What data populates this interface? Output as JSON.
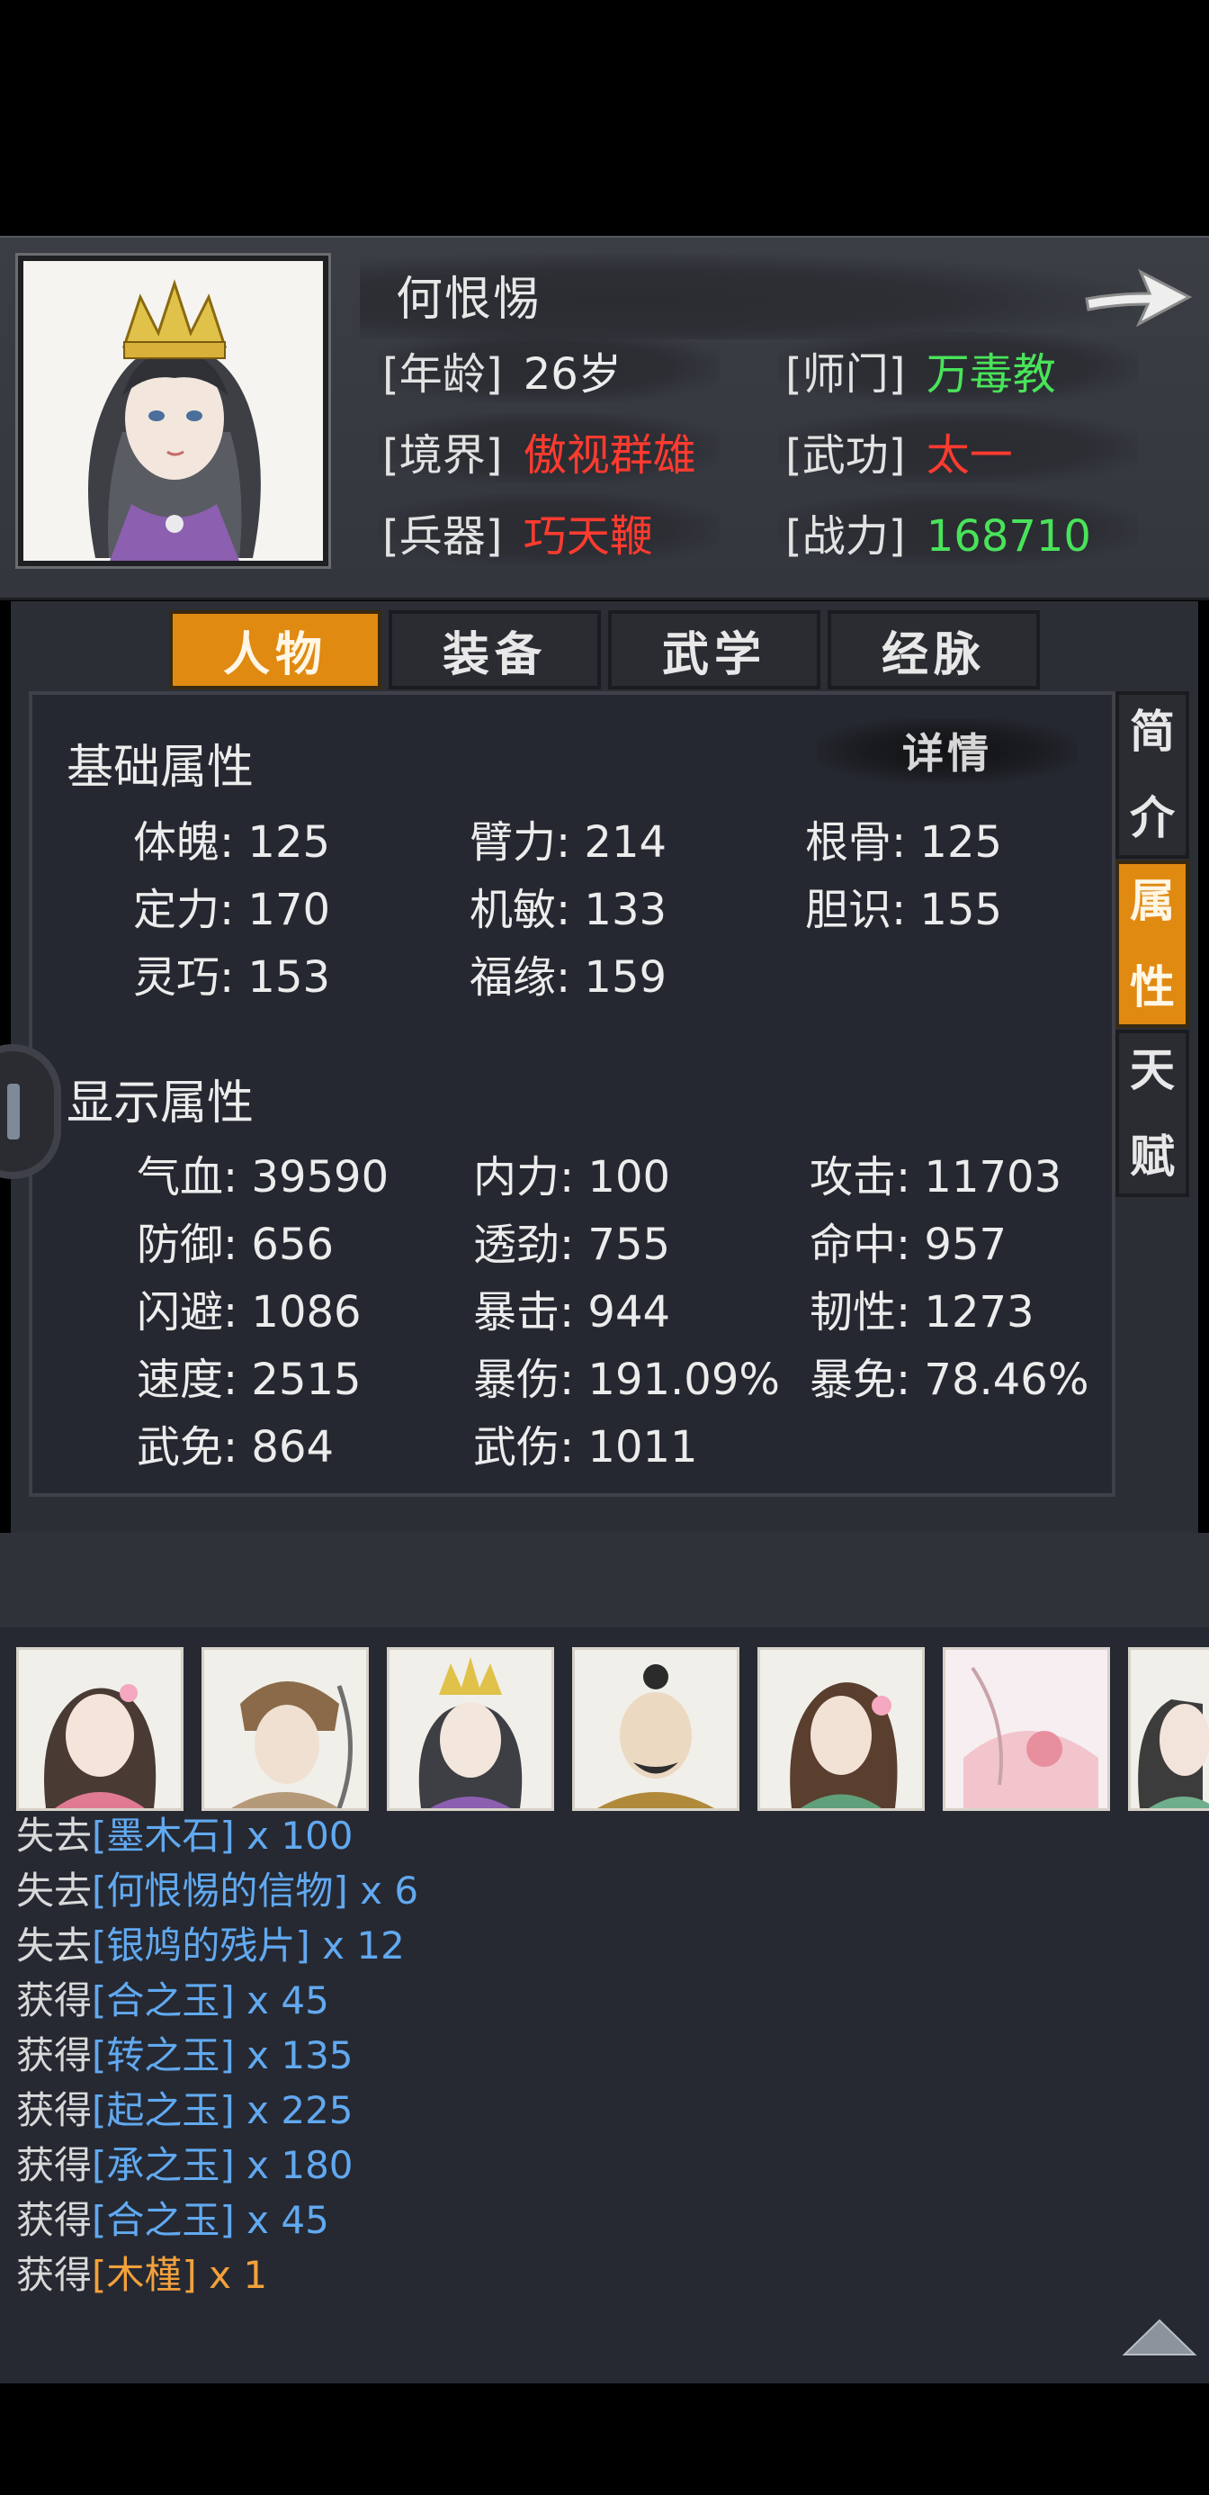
{
  "header": {
    "name": "何恨惕",
    "info": [
      {
        "label": "[年龄]",
        "value": "26岁",
        "color": "#ececec"
      },
      {
        "label": "[师门]",
        "value": "万毒教",
        "color": "#49e35a"
      },
      {
        "label": "[境界]",
        "value": "傲视群雄",
        "color": "#ff3b30"
      },
      {
        "label": "[武功]",
        "value": "太一",
        "color": "#ff3b30"
      },
      {
        "label": "[兵器]",
        "value": "巧天鞭",
        "color": "#ff3b30"
      },
      {
        "label": "[战力]",
        "value": "168710",
        "color": "#49e35a"
      }
    ]
  },
  "tabs": [
    "人物",
    "装备",
    "武学",
    "经脉"
  ],
  "active_tab": "人物",
  "side_tabs": [
    {
      "chars": [
        "简",
        "介"
      ],
      "active": false
    },
    {
      "chars": [
        "属",
        "性"
      ],
      "active": true
    },
    {
      "chars": [
        "天",
        "赋"
      ],
      "active": false
    }
  ],
  "detail_button": "详情",
  "base_section": {
    "title": "基础属性",
    "stats": [
      "体魄: 125",
      "臂力: 214",
      "根骨: 125",
      "定力: 170",
      "机敏: 133",
      "胆识: 155",
      "灵巧: 153",
      "福缘: 159"
    ]
  },
  "display_section": {
    "title": "显示属性",
    "stats": [
      "气血: 39590",
      "内力: 100",
      "攻击: 11703",
      "防御: 656",
      "透劲: 755",
      "命中: 957",
      "闪避: 1086",
      "暴击: 944",
      "韧性: 1273",
      "速度: 2515",
      "暴伤: 191.09%",
      "暴免: 78.46%",
      "武免: 864",
      "武伤: 1011"
    ]
  },
  "log": [
    {
      "verb": "失去",
      "item": "[墨木石]",
      "qty": " x 100",
      "color": "#61a9f0"
    },
    {
      "verb": "失去",
      "item": "[何恨惕的信物]",
      "qty": " x 6",
      "color": "#61a9f0"
    },
    {
      "verb": "失去",
      "item": "[银鸠的残片]",
      "qty": " x 12",
      "color": "#61a9f0"
    },
    {
      "verb": "获得",
      "item": "[合之玉]",
      "qty": " x 45",
      "color": "#61a9f0"
    },
    {
      "verb": "获得",
      "item": "[转之玉]",
      "qty": " x 135",
      "color": "#61a9f0"
    },
    {
      "verb": "获得",
      "item": "[起之玉]",
      "qty": " x 225",
      "color": "#61a9f0"
    },
    {
      "verb": "获得",
      "item": "[承之玉]",
      "qty": " x 180",
      "color": "#61a9f0"
    },
    {
      "verb": "获得",
      "item": "[合之玉]",
      "qty": " x 45",
      "color": "#61a9f0"
    },
    {
      "verb": "获得",
      "item": "[木槿]",
      "qty": " x 1",
      "color": "#f2a13b"
    }
  ],
  "colors": {
    "accent_orange": "#e08a12",
    "value_red": "#ff3b30",
    "value_green": "#49e35a",
    "item_blue": "#61a9f0",
    "item_orange": "#f2a13b"
  }
}
